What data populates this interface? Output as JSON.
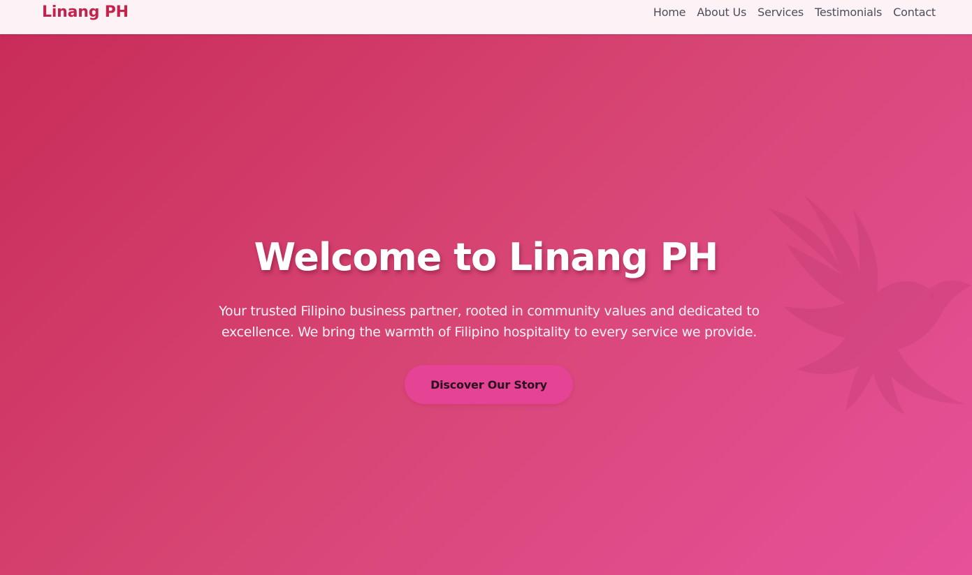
{
  "header": {
    "logo": "Linang PH",
    "nav": [
      {
        "label": "Home"
      },
      {
        "label": "About Us"
      },
      {
        "label": "Services"
      },
      {
        "label": "Testimonials"
      },
      {
        "label": "Contact"
      }
    ]
  },
  "hero": {
    "title": "Welcome to Linang PH",
    "text": "Your trusted Filipino business partner, rooted in community values and dedicated to excellence. We bring the warmth of Filipino hospitality to every service we provide.",
    "cta_label": "Discover Our Story",
    "decoration_icon": "bird-silhouette-icon"
  },
  "colors": {
    "brand": "#c2244e",
    "hero_gradient_start": "#c92c58",
    "hero_gradient_end": "#e6519a",
    "cta_background": "#e54393",
    "header_background": "#fdf3f6"
  }
}
